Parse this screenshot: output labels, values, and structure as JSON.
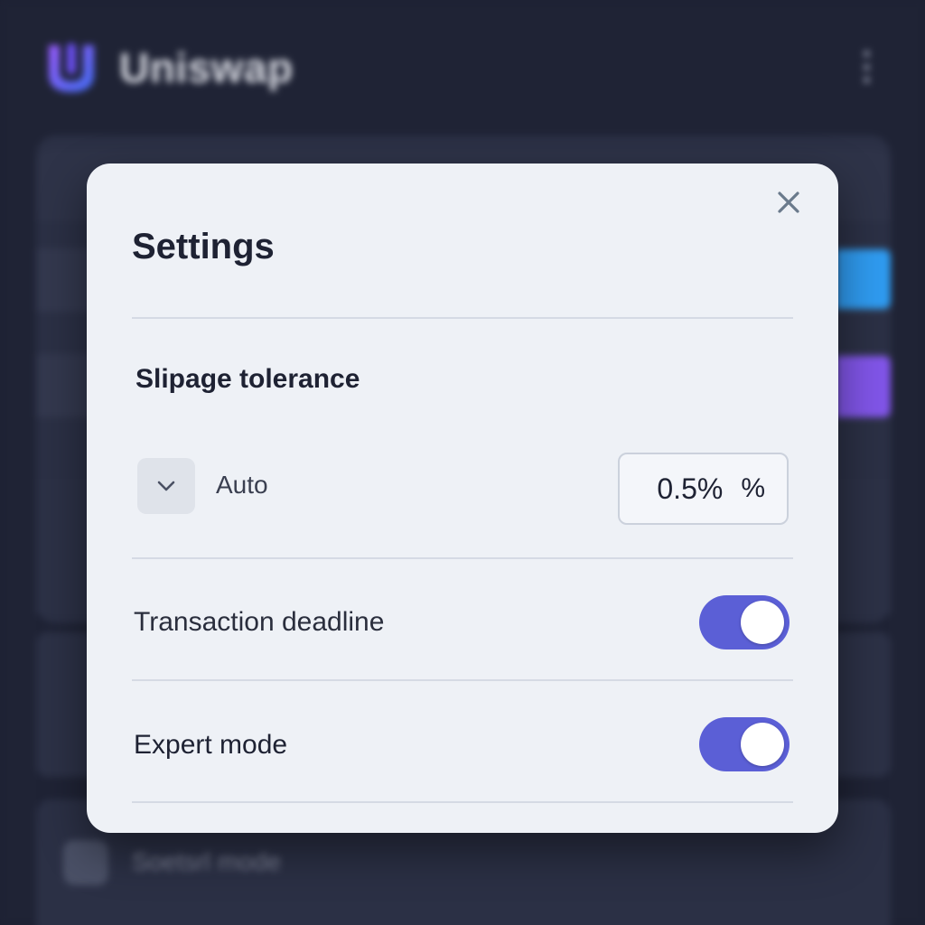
{
  "header": {
    "brand": "Uniswap"
  },
  "background": {
    "bottom_item_label": "Soetsrl mode"
  },
  "settings_modal": {
    "title": "Settings",
    "slippage": {
      "label": "Slipage tolerance",
      "auto_label": "Auto",
      "value": "0.5%",
      "unit": "%"
    },
    "transaction_deadline": {
      "label": "Transaction deadline",
      "enabled": true
    },
    "expert_mode": {
      "label": "Expert mode",
      "enabled": true
    }
  },
  "colors": {
    "toggle_on": "#5b5fd6",
    "modal_bg": "#eef1f6",
    "backdrop": "#1d2133",
    "accent_blue": "#2f9bf0",
    "accent_purple": "#8155e8"
  },
  "icons": {
    "close": "close-icon",
    "chevron": "chevron-down-icon",
    "logo": "uniswap-logo-icon",
    "menu": "more-vertical-icon"
  }
}
